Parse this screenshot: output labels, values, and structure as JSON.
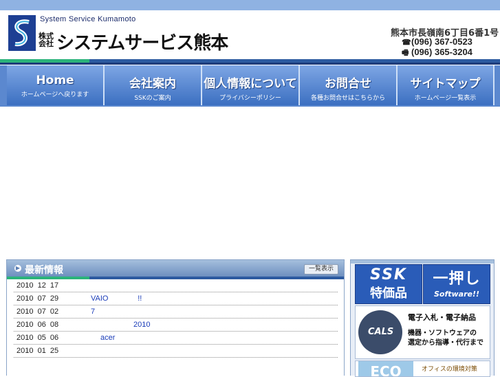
{
  "header": {
    "company_en": "System Service Kumamoto",
    "company_kk": "株式会社",
    "company_name": "システムサービス熊本",
    "address": "熊本市長嶺南6丁目6番1号",
    "tel": "(096) 367-0523",
    "fax": "(096) 365-3204"
  },
  "nav": [
    {
      "title": "Home",
      "sub": "ホームページへ戻ります"
    },
    {
      "title": "会社案内",
      "sub": "SSKのご案内"
    },
    {
      "title": "個人情報について",
      "sub": "プライバシーポリシー"
    },
    {
      "title": "お問合せ",
      "sub": "各種お問合せはこちらから"
    },
    {
      "title": "サイトマップ",
      "sub": "ホームページ一覧表示"
    }
  ],
  "news": {
    "title": "最新情報",
    "list_button": "一覧表示",
    "items": [
      {
        "date": "2010  12  17",
        "text": ""
      },
      {
        "date": "2010  07  29",
        "text": "VAIO              !!"
      },
      {
        "date": "2010  07  02",
        "text": "7"
      },
      {
        "date": "2010  06  08",
        "text": "2010"
      },
      {
        "date": "2010  05  06",
        "text": "acer"
      },
      {
        "date": "2010  01  25",
        "text": ""
      }
    ]
  },
  "side": {
    "ssk_title": "SSK",
    "ssk_sub": "特価品",
    "push_title": "一押し",
    "push_sub": "Software!!",
    "cals_label": "CALS",
    "cals_t1": "電子入札・電子納品",
    "cals_t2": "機器・ソフトウェアの",
    "cals_t3": "選定から指導・代行まで",
    "eco_label": "ECO",
    "eco_text": "オフィスの環境対策"
  },
  "colors": {
    "nav_blue": "#3b6fc1",
    "accent_green": "#2bb37a",
    "link_blue": "#1a3cb8"
  }
}
